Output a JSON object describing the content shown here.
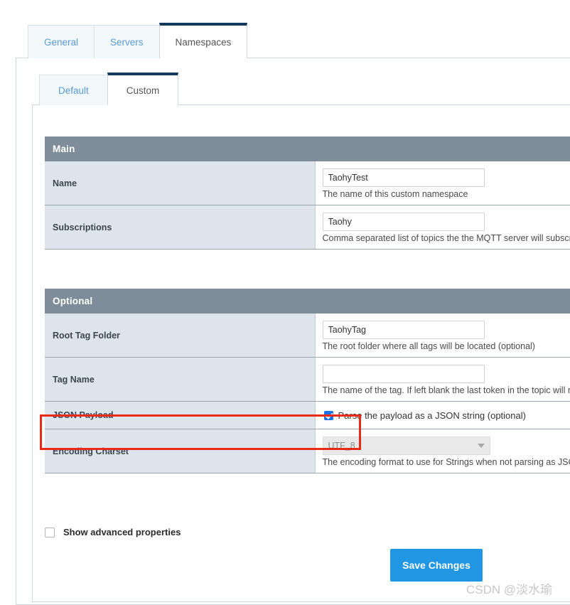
{
  "tabs_primary": [
    {
      "label": "General",
      "active": false
    },
    {
      "label": "Servers",
      "active": false
    },
    {
      "label": "Namespaces",
      "active": true
    }
  ],
  "tabs_secondary": [
    {
      "label": "Default",
      "active": false
    },
    {
      "label": "Custom",
      "active": true
    }
  ],
  "sections": {
    "main": {
      "header": "Main",
      "rows": [
        {
          "label": "Name",
          "value": "TaohyTest",
          "hint": "The name of this custom namespace"
        },
        {
          "label": "Subscriptions",
          "value": "Taohy",
          "hint": "Comma separated list of topics the the MQTT server will subscribe on"
        }
      ]
    },
    "optional": {
      "header": "Optional",
      "rows": [
        {
          "label": "Root Tag Folder",
          "value": "TaohyTag",
          "hint": "The root folder where all tags will be located (optional)"
        },
        {
          "label": "Tag Name",
          "value": "",
          "hint": "The name of the tag. If left blank the last token in the topic will represent the tag (optional)"
        },
        {
          "label": "JSON Payload",
          "checkbox_label": "Parse the payload as a JSON string (optional)",
          "checked": true
        },
        {
          "label": "Encoding Charset",
          "value": "UTF_8",
          "hint": "The encoding format to use for Strings when not parsing as JSON"
        }
      ]
    }
  },
  "footer": {
    "advanced_label": "Show advanced properties",
    "advanced_checked": false,
    "save_label": "Save Changes"
  },
  "watermark": "CSDN @淡水瑜",
  "colors": {
    "section_header_bg": "#7f8d9b",
    "label_cell_bg": "#dde4ec",
    "active_tab_border": "#14395c",
    "inactive_tab_text": "#5b9bd5",
    "highlight_red": "#e82b16",
    "save_button_bg": "#2196e3",
    "checkbox_checked": "#1a73e8"
  }
}
